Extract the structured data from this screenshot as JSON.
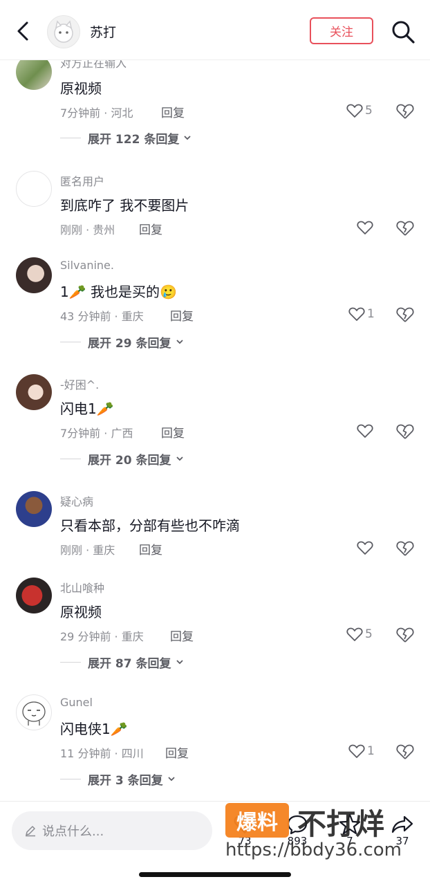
{
  "header": {
    "title": "苏打",
    "follow_label": "关注"
  },
  "comments": [
    {
      "name": "对方正在输入",
      "text": "原视频",
      "meta": "7分钟前 · 河北",
      "reply": "回复",
      "likes": "5",
      "expand": "展开 122 条回复"
    },
    {
      "name": "匿名用户",
      "text": "到底咋了  我不要图片",
      "meta": "刚刚 · 贵州",
      "reply": "回复",
      "likes": "",
      "expand": ""
    },
    {
      "name": "Silvanine.",
      "text": "1🥕 我也是买的🥲",
      "meta": "43 分钟前 · 重庆",
      "reply": "回复",
      "likes": "1",
      "expand": "展开 29 条回复"
    },
    {
      "name": "-好困^.",
      "text": "闪电1🥕",
      "meta": "7分钟前 · 广西",
      "reply": "回复",
      "likes": "",
      "expand": "展开 20 条回复"
    },
    {
      "name": "疑心病",
      "text": "只看本部，分部有些也不咋滴",
      "meta": "刚刚 · 重庆",
      "reply": "回复",
      "likes": "",
      "expand": ""
    },
    {
      "name": "北山喰种",
      "text": "原视频",
      "meta": "29 分钟前 · 重庆",
      "reply": "回复",
      "likes": "5",
      "expand": "展开 87 条回复"
    },
    {
      "name": "Gunel",
      "text": "闪电侠1🥕",
      "meta": "11 分钟前 · 四川",
      "reply": "回复",
      "likes": "1",
      "expand": "展开 3 条回复"
    }
  ],
  "bottom": {
    "placeholder": "说点什么...",
    "actions": [
      {
        "icon": "heart-icon",
        "count": "73"
      },
      {
        "icon": "chat-icon",
        "count": "893"
      },
      {
        "icon": "star-icon",
        "count": "7"
      },
      {
        "icon": "share-icon",
        "count": "37"
      }
    ]
  },
  "watermark": {
    "badge": "爆料",
    "text": "不打烊",
    "url": "https://bbdy36.com"
  },
  "colors": {
    "accent": "#e8505b",
    "secondary_text": "#8a8b91",
    "watermark_badge": "#f5821f"
  }
}
